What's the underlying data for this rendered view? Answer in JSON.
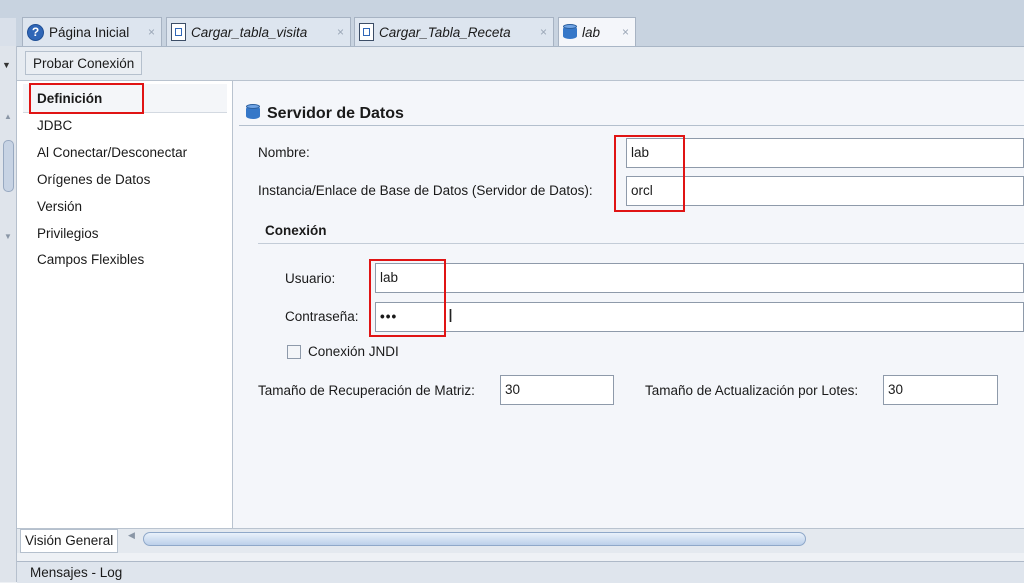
{
  "tabs": [
    {
      "label": "Página Inicial",
      "icon": "help-icon"
    },
    {
      "label": "Cargar_tabla_visita",
      "icon": "document-icon"
    },
    {
      "label": "Cargar_Tabla_Receta",
      "icon": "document-icon"
    },
    {
      "label": "lab",
      "icon": "database-icon"
    }
  ],
  "toolbar": {
    "test_connection": "Probar Conexión"
  },
  "nav": {
    "items": [
      "Definición",
      "JDBC",
      "Al Conectar/Desconectar",
      "Orígenes de Datos",
      "Versión",
      "Privilegios",
      "Campos Flexibles"
    ]
  },
  "section": {
    "title": "Servidor de Datos"
  },
  "form": {
    "name_label": "Nombre:",
    "name_value": "lab",
    "instance_label": "Instancia/Enlace de Base de Datos (Servidor de Datos):",
    "instance_value": "orcl",
    "connection_header": "Conexión",
    "user_label": "Usuario:",
    "user_value": "lab",
    "password_label": "Contraseña:",
    "password_value": "•••",
    "jndi_label": "Conexión JNDI",
    "fetch_label": "Tamaño de Recuperación de Matriz:",
    "fetch_value": "30",
    "batch_label": "Tamaño de Actualización por Lotes:",
    "batch_value": "30"
  },
  "bottom": {
    "overview_tab": "Visión General",
    "messages": "Mensajes - Log"
  },
  "colors": {
    "highlight": "#e01414",
    "accent": "#2f66b7"
  }
}
